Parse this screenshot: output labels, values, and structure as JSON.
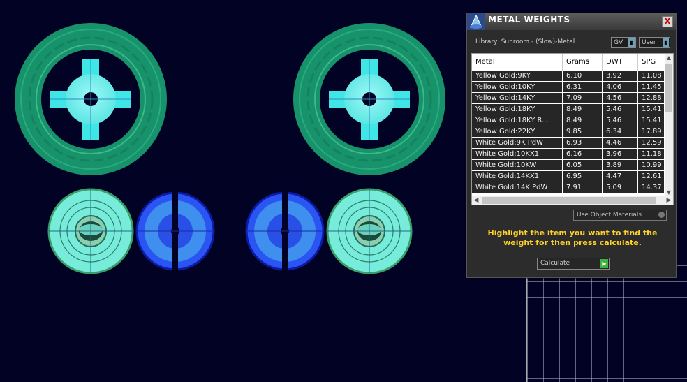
{
  "dialog": {
    "title": "METAL WEIGHTS",
    "close_label": "X",
    "library_label": "Library: Sunroom - (Slow)-Metal",
    "gv_select": "GV",
    "user_select": "User",
    "columns": [
      "Metal",
      "Grams",
      "DWT",
      "SPG"
    ],
    "rows": [
      [
        "Yellow Gold:9KY",
        "6.10",
        "3.92",
        "11.08"
      ],
      [
        "Yellow Gold:10KY",
        "6.31",
        "4.06",
        "11.45"
      ],
      [
        "Yellow Gold:14KY",
        "7.09",
        "4.56",
        "12.88"
      ],
      [
        "Yellow Gold:18KY",
        "8.49",
        "5.46",
        "15.41"
      ],
      [
        "Yellow Gold:18KY R...",
        "8.49",
        "5.46",
        "15.41"
      ],
      [
        "Yellow Gold:22KY",
        "9.85",
        "6.34",
        "17.89"
      ],
      [
        "White Gold:9K PdW",
        "6.93",
        "4.46",
        "12.59"
      ],
      [
        "White Gold:10KX1",
        "6.16",
        "3.96",
        "11.18"
      ],
      [
        "White Gold:10KW",
        "6.05",
        "3.89",
        "10.99"
      ],
      [
        "White Gold:14KX1",
        "6.95",
        "4.47",
        "12.61"
      ],
      [
        "White Gold:14K PdW",
        "7.91",
        "5.09",
        "14.37"
      ]
    ],
    "use_object_materials": "Use Object Materials",
    "instruction": "Highlight the item you want to find the weight for then press calculate.",
    "calculate_label": "Calculate"
  },
  "colors": {
    "background": "#020324",
    "ring_green": "#1c9c6c",
    "part_cyan": "#5ef0f0",
    "part_blue": "#1f4ff0",
    "instruction_yellow": "#ffd12a"
  }
}
